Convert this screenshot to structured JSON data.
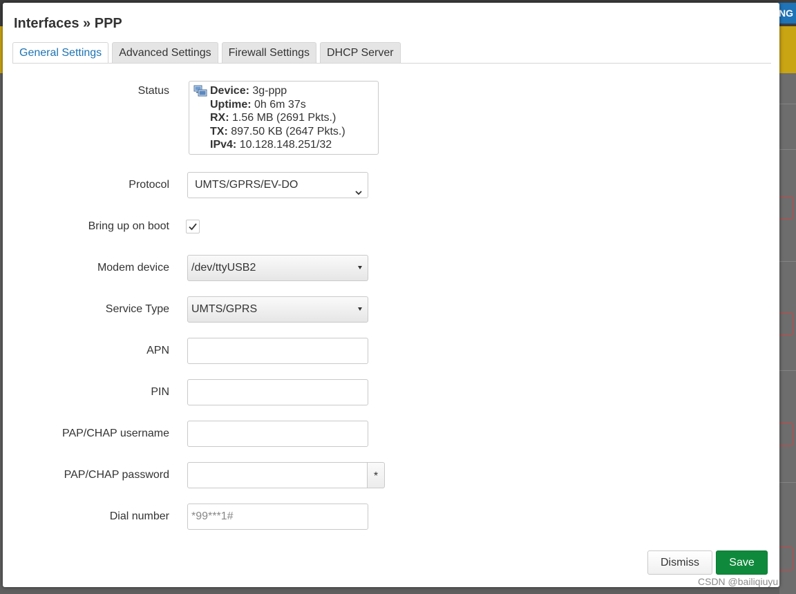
{
  "modal": {
    "title": "Interfaces » PPP",
    "tabs": [
      {
        "label": "General Settings",
        "active": true
      },
      {
        "label": "Advanced Settings"
      },
      {
        "label": "Firewall Settings"
      },
      {
        "label": "DHCP Server"
      }
    ]
  },
  "status": {
    "label": "Status",
    "icon": "network-device-icon",
    "lines": [
      {
        "key": "Device:",
        "value": "3g-ppp"
      },
      {
        "key": "Uptime:",
        "value": "0h 6m 37s"
      },
      {
        "key": "RX:",
        "value": "1.56 MB (2691 Pkts.)"
      },
      {
        "key": "TX:",
        "value": "897.50 KB (2647 Pkts.)"
      },
      {
        "key": "IPv4:",
        "value": "10.128.148.251/32"
      }
    ]
  },
  "fields": {
    "protocol": {
      "label": "Protocol",
      "value": "UMTS/GPRS/EV-DO"
    },
    "bring_up_on_boot": {
      "label": "Bring up on boot",
      "checked": true
    },
    "modem_device": {
      "label": "Modem device",
      "value": "/dev/ttyUSB2"
    },
    "service_type": {
      "label": "Service Type",
      "value": "UMTS/GPRS"
    },
    "apn": {
      "label": "APN",
      "value": ""
    },
    "pin": {
      "label": "PIN",
      "value": ""
    },
    "pap_chap_username": {
      "label": "PAP/CHAP username",
      "value": ""
    },
    "pap_chap_password": {
      "label": "PAP/CHAP password",
      "value": "",
      "toggle_label": "*"
    },
    "dial_number": {
      "label": "Dial number",
      "value": "",
      "placeholder": "*99***1#"
    }
  },
  "buttons": {
    "dismiss": "Dismiss",
    "save": "Save"
  },
  "background": {
    "topbar_button_fragment": "RING"
  },
  "watermark": "CSDN @bailiqiuyu",
  "colors": {
    "accent": "#1d73b3",
    "save": "#0f8a3c",
    "banner": "#c9a413"
  }
}
